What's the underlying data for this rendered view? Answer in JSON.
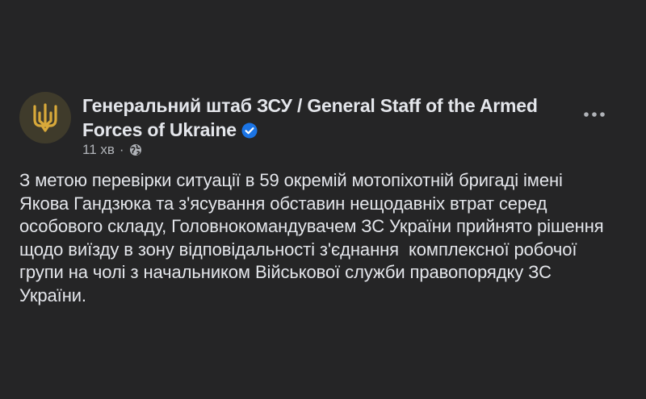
{
  "post": {
    "author": "Генеральний штаб ЗСУ / General Staff of the Armed Forces of Ukraine",
    "timestamp": "11 хв",
    "privacy_icon": "globe-icon",
    "verified_icon": "verified-badge-icon",
    "more_icon": "more-options-icon",
    "avatar_icon": "trident-emblem",
    "text": "З метою перевірки ситуації в 59 окремій мотопіхотній бригаді імені\nЯкова Гандзюка та з'ясування обставин нещодавніх втрат серед\nособового складу, Головнокомандувачем ЗС України прийнято рішення\nщодо виїзду в зону відповідальності з'єднання  комплексної робочої\nгрупи на чолі з начальником Військової служби правопорядку ЗС\nУкраїни."
  },
  "colors": {
    "background": "#252526",
    "text_primary": "#e4e6eb",
    "text_secondary": "#b0b3b8",
    "verified_blue": "#1b74e4",
    "avatar_bg": "#3f3b2b",
    "emblem_gold": "#d8a93a"
  }
}
